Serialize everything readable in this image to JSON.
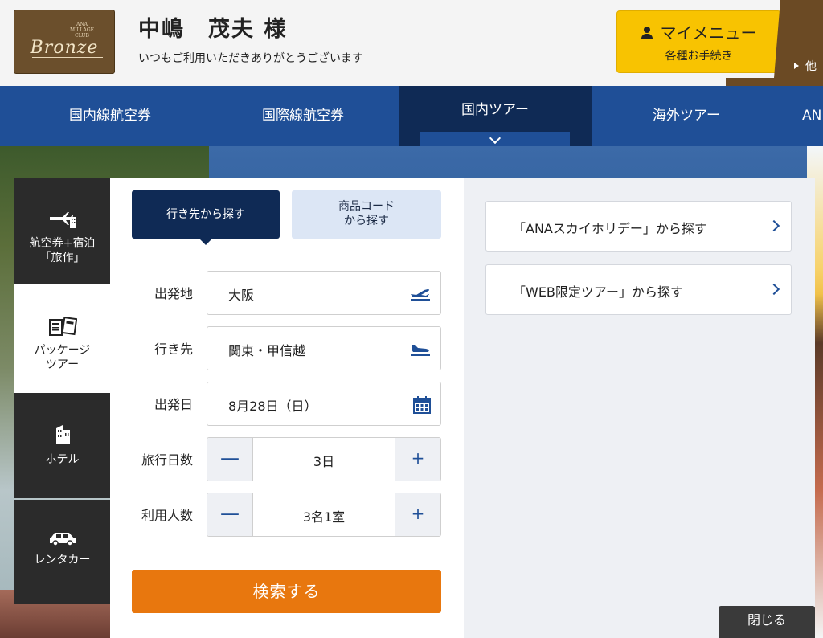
{
  "header": {
    "badge_club": "ANA MILLAGE CLUB",
    "badge_rank": "Bronze",
    "user_name": "中嶋　茂夫 様",
    "greeting": "いつもご利用いただきありがとうございます",
    "mymenu_title": "マイメニュー",
    "mymenu_sub": "各種お手続き",
    "other_label": "他"
  },
  "nav": {
    "items": [
      {
        "label": "国内線航空券"
      },
      {
        "label": "国際線航空券"
      },
      {
        "label": "国内ツアー"
      },
      {
        "label": "海外ツアー"
      },
      {
        "label": "AN"
      }
    ]
  },
  "sidebar": {
    "items": [
      {
        "line1": "航空券+宿泊",
        "line2": "「旅作」"
      },
      {
        "line1": "パッケージ",
        "line2": "ツアー"
      },
      {
        "line1": "ホテル"
      },
      {
        "line1": "レンタカー"
      }
    ]
  },
  "tabs": {
    "destination": "行き先から探す",
    "code_line1": "商品コード",
    "code_line2": "から探す"
  },
  "form": {
    "origin_label": "出発地",
    "origin_value": "大阪",
    "dest_label": "行き先",
    "dest_value": "関東・甲信越",
    "date_label": "出発日",
    "date_value": "8月28日（日）",
    "days_label": "旅行日数",
    "days_value": "3日",
    "people_label": "利用人数",
    "people_value": "3名1室",
    "minus": "—",
    "plus": "+",
    "search": "検索する"
  },
  "links": {
    "skyholiday": "「ANAスカイホリデー」から探す",
    "web_limited": "「WEB限定ツアー」から探す"
  },
  "close": "閉じる",
  "colors": {
    "nav": "#1f4f97",
    "nav_active": "#0f2a55",
    "mymenu": "#f8c301",
    "search": "#e8770e"
  }
}
